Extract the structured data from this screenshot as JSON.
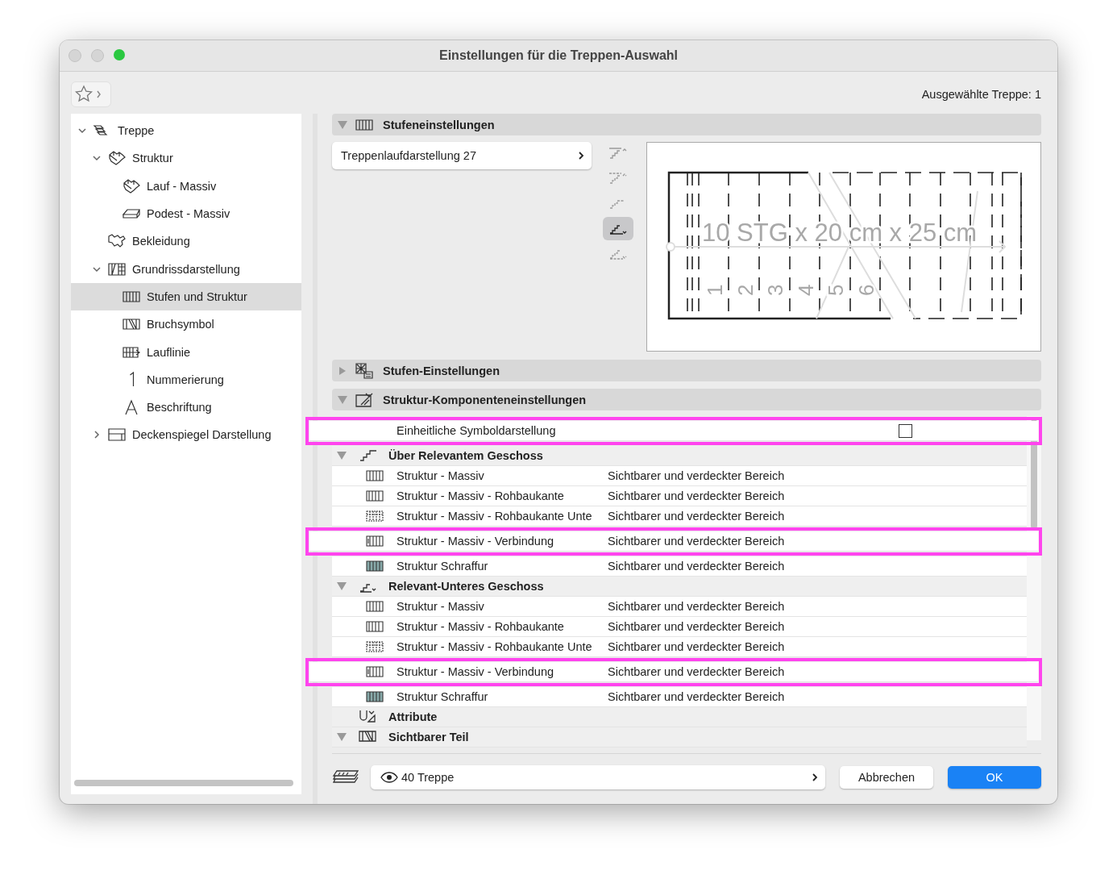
{
  "window": {
    "title": "Einstellungen für die Treppen-Auswahl"
  },
  "toolbar": {
    "selection_info": "Ausgewählte Treppe: 1"
  },
  "tree": [
    {
      "label": "Treppe",
      "expanded": true,
      "selected": false,
      "children": [
        {
          "label": "Struktur",
          "expanded": true,
          "selected": false,
          "children": [
            {
              "label": "Lauf - Massiv",
              "selected": false
            },
            {
              "label": "Podest - Massiv",
              "selected": false
            }
          ]
        },
        {
          "label": "Bekleidung",
          "selected": false
        },
        {
          "label": "Grundrissdarstellung",
          "expanded": true,
          "selected": false,
          "children": [
            {
              "label": "Stufen und Struktur",
              "selected": true
            },
            {
              "label": "Bruchsymbol",
              "selected": false
            },
            {
              "label": "Lauflinie",
              "selected": false
            },
            {
              "label": "Nummerierung",
              "selected": false
            },
            {
              "label": "Beschriftung",
              "selected": false
            }
          ]
        },
        {
          "label": "Deckenspiegel Darstellung",
          "expanded": false,
          "selected": false
        }
      ]
    }
  ],
  "step_settings": {
    "title": "Stufeneinstellungen",
    "expanded": true,
    "preset": "Treppenlaufdarstellung 27",
    "view_buttons": [
      {
        "selected": false
      },
      {
        "selected": false
      },
      {
        "selected": false
      },
      {
        "selected": true
      },
      {
        "selected": false
      }
    ],
    "preview": {
      "label": "10 STG x 20 cm x 25 cm",
      "step_numbers": [
        "1",
        "2",
        "3",
        "4",
        "5",
        "6"
      ]
    }
  },
  "step_details": {
    "title": "Stufen-Einstellungen",
    "expanded": false
  },
  "structure_components": {
    "title": "Struktur-Komponenteneinstellungen",
    "expanded": true,
    "rows": [
      {
        "kind": "option",
        "label": "Einheitliche Symboldarstellung",
        "checked": false,
        "highlighted": true
      },
      {
        "kind": "group",
        "label": "Über Relevantem Geschoss",
        "expanded": true,
        "highlighted": false
      },
      {
        "kind": "item",
        "label": "Struktur - Massiv",
        "value": "Sichtbarer und verdeckter Bereich",
        "highlighted": false
      },
      {
        "kind": "item",
        "label": "Struktur - Massiv - Rohbaukante",
        "value": "Sichtbarer und verdeckter Bereich",
        "highlighted": false
      },
      {
        "kind": "item",
        "label": "Struktur - Massiv - Rohbaukante Unte",
        "value": "Sichtbarer und verdeckter Bereich",
        "highlighted": false
      },
      {
        "kind": "item",
        "label": "Struktur - Massiv - Verbindung",
        "value": "Sichtbarer und verdeckter Bereich",
        "highlighted": true
      },
      {
        "kind": "item",
        "label": "Struktur Schraffur",
        "value": "Sichtbarer und verdeckter Bereich",
        "highlighted": false
      },
      {
        "kind": "group",
        "label": "Relevant-Unteres Geschoss",
        "expanded": true,
        "highlighted": false
      },
      {
        "kind": "item",
        "label": "Struktur - Massiv",
        "value": "Sichtbarer und verdeckter Bereich",
        "highlighted": false
      },
      {
        "kind": "item",
        "label": "Struktur - Massiv - Rohbaukante",
        "value": "Sichtbarer und verdeckter Bereich",
        "highlighted": false
      },
      {
        "kind": "item",
        "label": "Struktur - Massiv - Rohbaukante Unte",
        "value": "Sichtbarer und verdeckter Bereich",
        "highlighted": false
      },
      {
        "kind": "item",
        "label": "Struktur - Massiv - Verbindung",
        "value": "Sichtbarer und verdeckter Bereich",
        "highlighted": true
      },
      {
        "kind": "item",
        "label": "Struktur Schraffur",
        "value": "Sichtbarer und verdeckter Bereich",
        "highlighted": false
      },
      {
        "kind": "group",
        "label": "Attribute",
        "highlighted": false
      },
      {
        "kind": "group",
        "label": "Sichtbarer Teil",
        "expanded": true,
        "highlighted": false
      }
    ]
  },
  "footer": {
    "layer": "40 Treppe",
    "buttons": [
      {
        "label": "Abbrechen",
        "kind": "cancel"
      },
      {
        "label": "OK",
        "kind": "default"
      }
    ]
  }
}
